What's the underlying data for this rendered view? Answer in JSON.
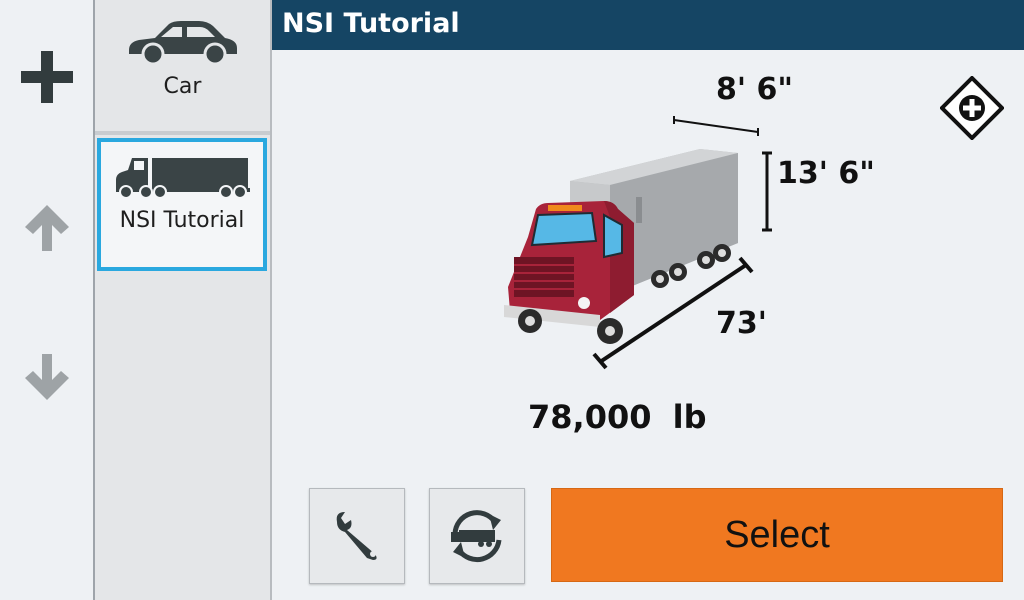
{
  "header": {
    "title": "NSI Tutorial"
  },
  "left_rail": {
    "add_icon": "plus-icon",
    "up_icon": "arrow-up-icon",
    "down_icon": "arrow-down-icon"
  },
  "profiles": [
    {
      "label": "Car",
      "icon": "car-icon",
      "selected": false
    },
    {
      "label": "NSI Tutorial",
      "icon": "truck-icon",
      "selected": true
    }
  ],
  "vehicle": {
    "width": "8' 6\"",
    "height": "13' 6\"",
    "length": "73'",
    "weight": "78,000 lb"
  },
  "actions": {
    "settings_icon": "wrench-icon",
    "switch_icon": "switch-trailer-icon",
    "select_label": "Select",
    "add_icon": "add-diamond-icon"
  },
  "colors": {
    "header": "#154564",
    "accent": "#2aa8df",
    "select": "#f07820"
  }
}
